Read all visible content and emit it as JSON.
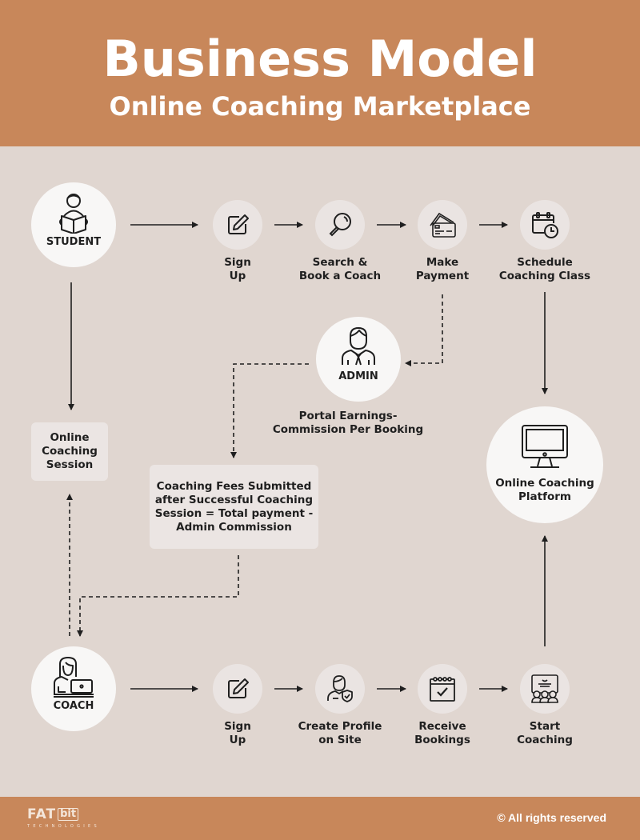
{
  "header": {
    "title": "Business Model",
    "subtitle": "Online Coaching Marketplace"
  },
  "colors": {
    "brand": "#c8875a",
    "background": "#e0d6d0",
    "node": "#f8f7f6",
    "step": "#eae4e2",
    "ink": "#1f1f1f"
  },
  "student": {
    "label": "STUDENT",
    "icon": "student-reading-icon",
    "steps": [
      {
        "label_line1": "Sign",
        "label_line2": "Up",
        "icon": "edit-icon"
      },
      {
        "label_line1": "Search &",
        "label_line2": "Book a Coach",
        "icon": "search-icon"
      },
      {
        "label_line1": "Make",
        "label_line2": "Payment",
        "icon": "credit-card-icon"
      },
      {
        "label_line1": "Schedule",
        "label_line2": "Coaching Class",
        "icon": "calendar-clock-icon"
      }
    ]
  },
  "admin": {
    "label": "ADMIN",
    "icon": "admin-person-icon",
    "caption_line1": "Portal Earnings-",
    "caption_line2": "Commission Per Booking"
  },
  "session_box": {
    "line1": "Online",
    "line2": "Coaching",
    "line3": "Session"
  },
  "fees_box": {
    "line1": "Coaching Fees Submitted",
    "line2": "after Successful Coaching",
    "line3": "Session = Total payment -",
    "line4": "Admin Commission"
  },
  "platform": {
    "line1": "Online Coaching",
    "line2": "Platform",
    "icon": "monitor-icon"
  },
  "coach": {
    "label": "COACH",
    "icon": "coach-laptop-icon",
    "steps": [
      {
        "label_line1": "Sign",
        "label_line2": "Up",
        "icon": "edit-icon"
      },
      {
        "label_line1": "Create Profile",
        "label_line2": "on Site",
        "icon": "verified-profile-icon"
      },
      {
        "label_line1": "Receive",
        "label_line2": "Bookings",
        "icon": "calendar-check-icon"
      },
      {
        "label_line1": "Start",
        "label_line2": "Coaching",
        "icon": "classroom-icon"
      }
    ]
  },
  "footer": {
    "logo_main": "FAT",
    "logo_box": "bit",
    "logo_sub": "TECHNOLOGIES",
    "rights": "© All rights reserved"
  }
}
